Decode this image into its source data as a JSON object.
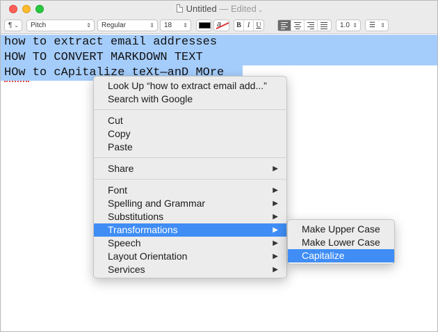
{
  "window": {
    "title": "Untitled",
    "status": "— Edited",
    "chevron": "⌄"
  },
  "toolbar": {
    "paragraph_style": "¶",
    "font_family": "Pitch",
    "font_style": "Regular",
    "font_size": "18",
    "text_color": "#000000",
    "bold": "B",
    "italic": "I",
    "underline": "U",
    "alignment_active": "left",
    "line_spacing": "1.0",
    "list_style": "list-icon"
  },
  "document": {
    "lines": [
      "how to extract email addresses",
      "HOW TO CONVERT MARKDOWN TEXT",
      "HOw to cApitalize teXt—anD MOre"
    ],
    "selection_color": "#a5cdfb"
  },
  "context_menu": {
    "look_up": "Look Up “how to extract email add...”",
    "search_google": "Search with Google",
    "cut": "Cut",
    "copy": "Copy",
    "paste": "Paste",
    "share": "Share",
    "font": "Font",
    "spelling": "Spelling and Grammar",
    "substitutions": "Substitutions",
    "transformations": "Transformations",
    "speech": "Speech",
    "layout_orientation": "Layout Orientation",
    "services": "Services",
    "submenu_arrow": "▶"
  },
  "transformations_menu": {
    "upper": "Make Upper Case",
    "lower": "Make Lower Case",
    "capitalize": "Capitalize"
  },
  "colors": {
    "highlight": "#3f8df5",
    "close": "#fc5f57",
    "minimize": "#fdbb2e",
    "maximize": "#29c840"
  }
}
